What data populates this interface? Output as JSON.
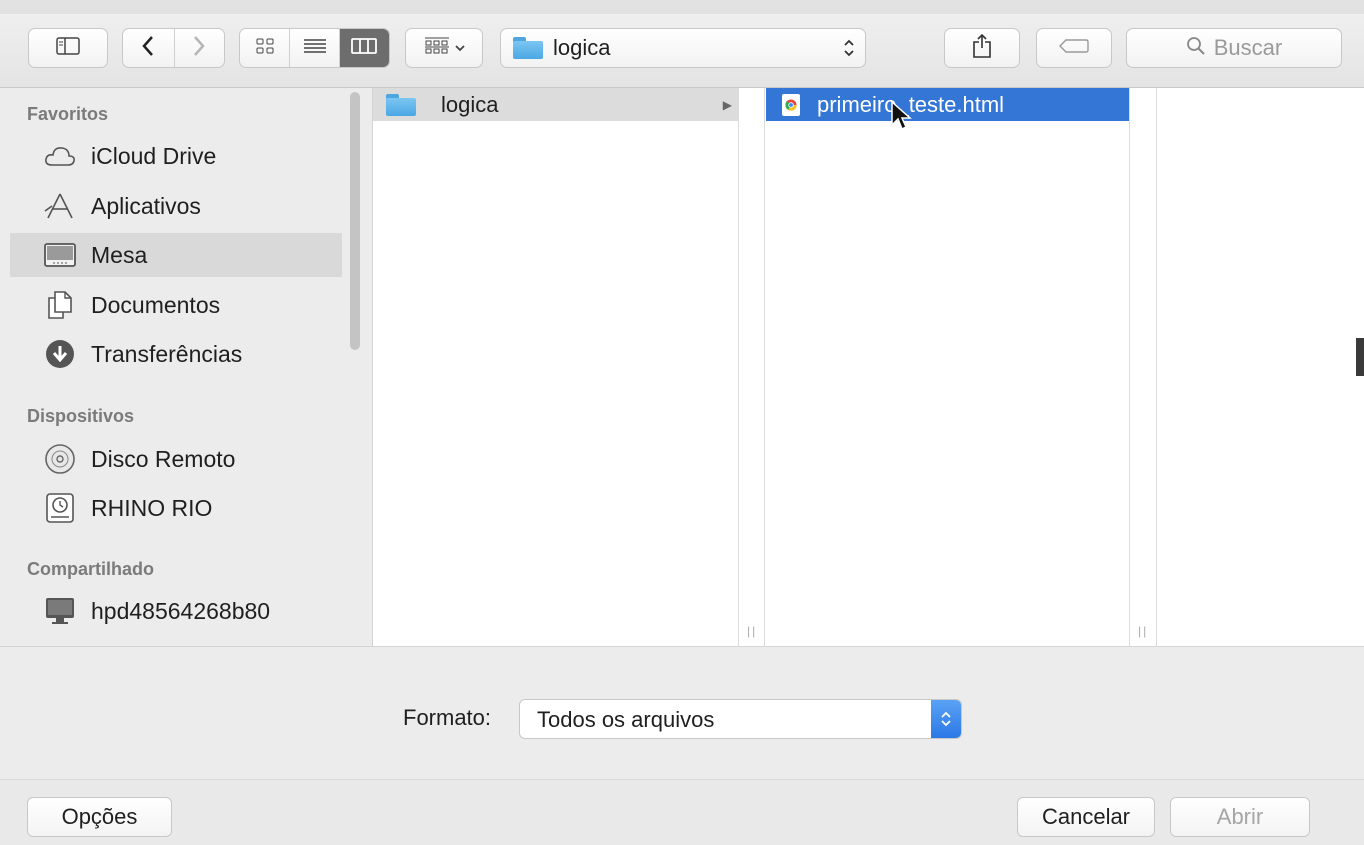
{
  "toolbar": {
    "path_popup_label": "logica",
    "search_placeholder": "Buscar"
  },
  "sidebar": {
    "sections": [
      {
        "title": "Favoritos",
        "items": [
          {
            "label": "iCloud Drive",
            "icon": "cloud-icon"
          },
          {
            "label": "Aplicativos",
            "icon": "applications-icon"
          },
          {
            "label": "Mesa",
            "icon": "desktop-icon",
            "selected": true
          },
          {
            "label": "Documentos",
            "icon": "documents-icon"
          },
          {
            "label": "Transferências",
            "icon": "downloads-icon"
          }
        ]
      },
      {
        "title": "Dispositivos",
        "items": [
          {
            "label": "Disco Remoto",
            "icon": "disc-icon"
          },
          {
            "label": "RHINO RIO",
            "icon": "time-machine-disk-icon"
          }
        ]
      },
      {
        "title": "Compartilhado",
        "items": [
          {
            "label": "hpd48564268b80",
            "icon": "computer-icon"
          }
        ]
      }
    ]
  },
  "browser": {
    "columns": [
      {
        "items": [
          {
            "label": "logica",
            "type": "folder",
            "selected": true
          }
        ]
      },
      {
        "items": [
          {
            "label": "primeiro_teste.html",
            "type": "html-file",
            "selected": true
          }
        ]
      }
    ]
  },
  "bottom": {
    "format_label": "Formato:",
    "format_value": "Todos os arquivos",
    "options_button": "Opções",
    "cancel_button": "Cancelar",
    "open_button": "Abrir"
  },
  "colors": {
    "selection_blue": "#3476d5",
    "sidebar_selected": "#d9d9d9",
    "accent_select": "#2c78e6"
  }
}
